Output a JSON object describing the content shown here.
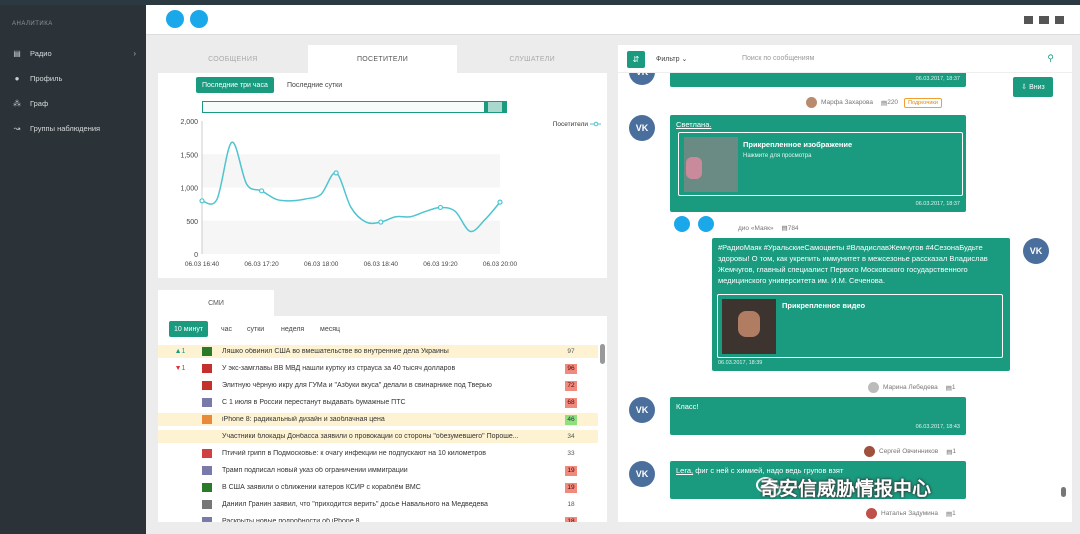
{
  "sidebar": {
    "section": "АНАЛИТИКА",
    "items": [
      {
        "label": "Радио",
        "icon": "radio-icon",
        "chevron": "›"
      },
      {
        "label": "Профиль",
        "icon": "user-icon"
      },
      {
        "label": "Граф",
        "icon": "graph-icon"
      },
      {
        "label": "Группы наблюдения",
        "icon": "chart-icon"
      }
    ]
  },
  "tabs": [
    "СООБЩЕНИЯ",
    "ПОСЕТИТЕЛИ",
    "СЛУШАТЕЛИ"
  ],
  "range_buttons": [
    "Последние три часа",
    "Последние сутки"
  ],
  "chart_data": {
    "type": "line",
    "x": [
      "06.03 16:40",
      "06.03 16:50",
      "06.03 17:00",
      "06.03 17:10",
      "06.03 17:20",
      "06.03 17:30",
      "06.03 17:40",
      "06.03 17:50",
      "06.03 18:00",
      "06.03 18:10",
      "06.03 18:20",
      "06.03 18:30",
      "06.03 18:40",
      "06.03 18:50",
      "06.03 19:00",
      "06.03 19:10",
      "06.03 19:20",
      "06.03 19:30",
      "06.03 19:40",
      "06.03 19:50",
      "06.03 20:00"
    ],
    "series": [
      {
        "name": "Посетители",
        "values": [
          800,
          820,
          1680,
          1050,
          950,
          820,
          800,
          830,
          900,
          1220,
          700,
          480,
          480,
          560,
          560,
          640,
          700,
          640,
          340,
          520,
          780
        ]
      }
    ],
    "xticks": [
      "06.03 16:40",
      "06.03 17:20",
      "06.03 18:00",
      "06.03 18:40",
      "06.03 19:20",
      "06.03 20:00"
    ],
    "yticks": [
      "2,000",
      "1,500",
      "1,000",
      "500",
      "0"
    ],
    "ylim": [
      0,
      2000
    ],
    "legend": "Посетители",
    "legend_position": "right",
    "color": "#4fc4cf",
    "marker_indices": [
      0,
      4,
      9,
      12,
      16,
      20
    ]
  },
  "smi": {
    "tab": "СМИ",
    "periods": [
      "10 минут",
      "час",
      "сутки",
      "неделя",
      "месяц"
    ],
    "rows": [
      {
        "trend": "▲1",
        "dir": "up",
        "src_color": "#2a7a2a",
        "title": "Ляшко обвинил США во вмешательстве во внутренние дела Украины",
        "count": "97",
        "cc": "n",
        "hl": true
      },
      {
        "trend": "▼1",
        "dir": "down",
        "src_color": "#c4302b",
        "title": "У экс-замглавы ВВ МВД нашли куртку из страуса за 40 тысяч долларов",
        "count": "96",
        "cc": "r",
        "hl": false
      },
      {
        "trend": "",
        "dir": "",
        "src_color": "#c4302b",
        "title": "Элитную чёрную икру для ГУМа и \"Азбуки вкуса\" делали в свинарнике под Тверью",
        "count": "72",
        "cc": "r",
        "hl": false
      },
      {
        "trend": "",
        "dir": "",
        "src_color": "#7a7aaa",
        "title": "С 1 июля в России перестанут выдавать бумажные ПТС",
        "count": "68",
        "cc": "r",
        "hl": false
      },
      {
        "trend": "",
        "dir": "",
        "src_color": "#e88a3a",
        "title": "iPhone 8: радикальный дизайн и заоблачная цена",
        "count": "46",
        "cc": "g",
        "hl": true
      },
      {
        "trend": "",
        "dir": "",
        "src_color": "",
        "title": "Участники блокады Донбасса заявили о провокации со стороны \"обезумевшего\" Пороше...",
        "count": "34",
        "cc": "n",
        "hl": true
      },
      {
        "trend": "",
        "dir": "",
        "src_color": "#d04040",
        "title": "Птичий грипп в Подмосковье: к очагу инфекции не подпускают на 10 километров",
        "count": "33",
        "cc": "n",
        "hl": false
      },
      {
        "trend": "",
        "dir": "",
        "src_color": "#7a7aaa",
        "title": "Трамп подписал новый указ об ограничении иммиграции",
        "count": "19",
        "cc": "r",
        "hl": false
      },
      {
        "trend": "",
        "dir": "",
        "src_color": "#2a7a2a",
        "title": "В США заявили о сближении катеров КСИР с кораблём ВМС",
        "count": "19",
        "cc": "r",
        "hl": false
      },
      {
        "trend": "",
        "dir": "",
        "src_color": "#777",
        "title": "Даниил Гранин заявил, что \"приходится верить\" досье Навального на Медведева",
        "count": "18",
        "cc": "n",
        "hl": false
      },
      {
        "trend": "",
        "dir": "",
        "src_color": "#7a7aaa",
        "title": "Раскрыты новые подробности об iPhone 8",
        "count": "18",
        "cc": "r",
        "hl": false
      }
    ]
  },
  "right": {
    "filter": "Фильтр",
    "search_placeholder": "Поиск по сообщениям",
    "down_button": "Вниз",
    "msg1_ts": "06.03.2017, 18:37",
    "meta1_name": "Марфа Захарова",
    "meta1_count": "220",
    "meta1_badge": "Подрезчики",
    "msg2_author": "Светлана.",
    "att_image_title": "Прикрепленное изображение",
    "att_image_sub": "Нажмите для просмотра",
    "msg2_ts": "06.03.2017, 18:37",
    "meta2_name": "дио «Маяк»",
    "meta2_count": "784",
    "msg3_text": "#РадиоМаяк #УральскиеСамоцветы #ВладиславЖемчугов #4СезонаБудьте здоровы! О том, как укрепить иммунитет в межсезонье рассказал Владислав Жемчугов, главный специалист Первого Московского государственного медицинского университета им. И.М. Сеченова.",
    "att_video_title": "Прикрепленное видео",
    "msg3_ts": "06.03.2017, 18:39",
    "meta3_name": "Марина Лебедева",
    "meta3_count": "1",
    "msg4_text": "Класс!",
    "msg4_ts": "06.03.2017, 18:43",
    "meta4_name": "Сергей Овчинников",
    "meta4_count": "1",
    "msg5_author": "Lera,",
    "msg5_text": "фиг с ней с химией, надо ведь групов взят",
    "meta5_name": "Наталья Задумина",
    "meta5_count": "1",
    "vk": "VK"
  },
  "watermark": "奇安信威胁情报中心"
}
